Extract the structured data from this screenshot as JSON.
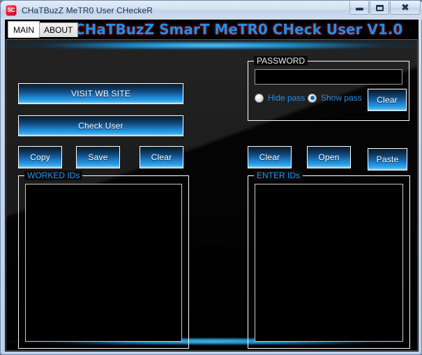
{
  "window": {
    "title": "CHaTBuzZ MeTR0 User CHeckeR",
    "icon_label": "SC",
    "icon_name": "app-icon-sc",
    "controls": {
      "minimize": "–",
      "maximize": "□",
      "close": "✖"
    }
  },
  "tabs": [
    {
      "label": "MAIN",
      "selected": true
    },
    {
      "label": "ABOUT",
      "selected": false
    }
  ],
  "header": {
    "title": "CHaTBuzZ SmarT MeTR0 CHeck User V1.0",
    "title_color": "#1f8fe8",
    "glow_color": "#8d1111"
  },
  "left": {
    "visit_site_button": "VISIT WB SITE",
    "check_user_button": "Check User",
    "copy_button": "Copy",
    "save_button": "Save",
    "clear_button": "Clear",
    "worked_group_label": "WORKED IDs",
    "worked_ids_value": "",
    "worked_ids_placeholder": ""
  },
  "right": {
    "password_group_label": "PASSWORD",
    "password_value": "",
    "password_placeholder": "",
    "hide_pass_label": "Hide pass",
    "show_pass_label": "Show pass",
    "hide_pass_checked": false,
    "show_pass_checked": true,
    "password_clear_button": "Clear",
    "clear_button": "Clear",
    "open_button": "Open",
    "paste_button": "Paste",
    "enter_group_label": "ENTER IDs",
    "enter_ids_value": "",
    "enter_ids_placeholder": ""
  },
  "theme": {
    "background": "#000000",
    "panel": "#1a1a1a",
    "accent_blue": "#2a8fe8",
    "glow_cyan": "#4fbcea",
    "button_border": "#ffffff"
  }
}
